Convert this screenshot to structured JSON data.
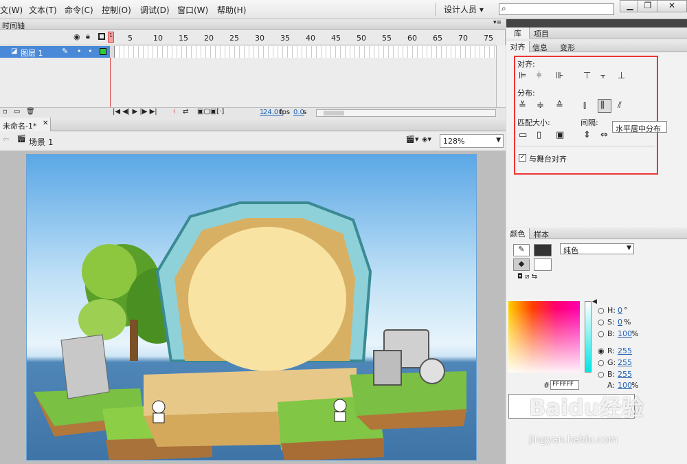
{
  "menu": [
    "文(W)",
    "文本(T)",
    "命令(C)",
    "控制(O)",
    "调试(D)",
    "窗口(W)",
    "帮助(H)"
  ],
  "designer": "设计人员",
  "search_placeholder": "",
  "timeline": {
    "tab": "时间轴",
    "layer": "图层 1",
    "frames": [
      "1",
      "5",
      "10",
      "15",
      "20",
      "25",
      "30",
      "35",
      "40",
      "45",
      "50",
      "55",
      "60",
      "65",
      "70",
      "75"
    ],
    "current_frame": "1",
    "fps": "24.00",
    "fps_unit": "fps",
    "time": "0.0",
    "time_unit": "s"
  },
  "document": {
    "tab": "未命名-1*",
    "scene": "场景 1",
    "zoom": "128%"
  },
  "right_panel": {
    "top_tabs": [
      "库",
      "项目"
    ],
    "align_tabs": [
      "对齐",
      "信息",
      "变形"
    ],
    "align_label": "对齐:",
    "distribute_label": "分布:",
    "match_size_label": "匹配大小:",
    "spacing_label": "间隔:",
    "tooltip": "水平居中分布",
    "align_to_stage": "与舞台对齐",
    "color_tabs": [
      "颜色",
      "样本"
    ],
    "fill_type": "纯色",
    "hex": "FFFFFF",
    "hsb": [
      {
        "k": "H:",
        "v": "0",
        "u": "°"
      },
      {
        "k": "S:",
        "v": "0",
        "u": "%"
      },
      {
        "k": "B:",
        "v": "100",
        "u": "%"
      }
    ],
    "rgb": [
      {
        "k": "R:",
        "v": "255"
      },
      {
        "k": "G:",
        "v": "255"
      },
      {
        "k": "B:",
        "v": "255"
      }
    ],
    "alpha_label": "A:",
    "alpha": "100",
    "alpha_unit": "%"
  },
  "watermark": {
    "brand": "Baidu经验",
    "url": "jingyan.baidu.com"
  }
}
